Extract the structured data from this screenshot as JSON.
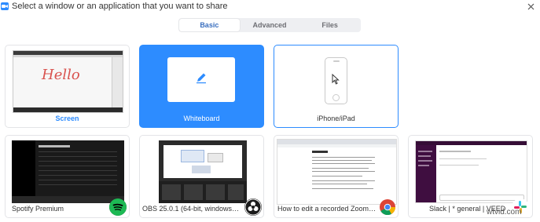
{
  "window": {
    "title": "Select a window or an application that you want to share",
    "app_icon": "zoom-camera-icon",
    "close_icon": "close-icon"
  },
  "tabs": [
    {
      "label": "Basic",
      "active": true
    },
    {
      "label": "Advanced",
      "active": false
    },
    {
      "label": "Files",
      "active": false
    }
  ],
  "basic_row": {
    "screen": {
      "label": "Screen",
      "thumb_text": "Hello"
    },
    "whiteboard": {
      "label": "Whiteboard",
      "icon": "pencil-icon"
    },
    "iphone": {
      "label": "iPhone/iPad",
      "icon": "phone-icon"
    }
  },
  "windows": [
    {
      "label": "Spotify Premium",
      "badge": "spotify-icon"
    },
    {
      "label": "OBS 25.0.1 (64-bit, windows) - Pr...",
      "badge": "obs-icon"
    },
    {
      "label": "How to edit a recorded Zoom co...",
      "badge": "chrome-icon"
    },
    {
      "label": "Slack | * general | VEED",
      "badge": "slack-icon"
    }
  ],
  "watermark": "wtvid.com",
  "colors": {
    "accent": "#2d8cff",
    "tab_active_text": "#3a6fbf",
    "spotify": "#1db954"
  }
}
